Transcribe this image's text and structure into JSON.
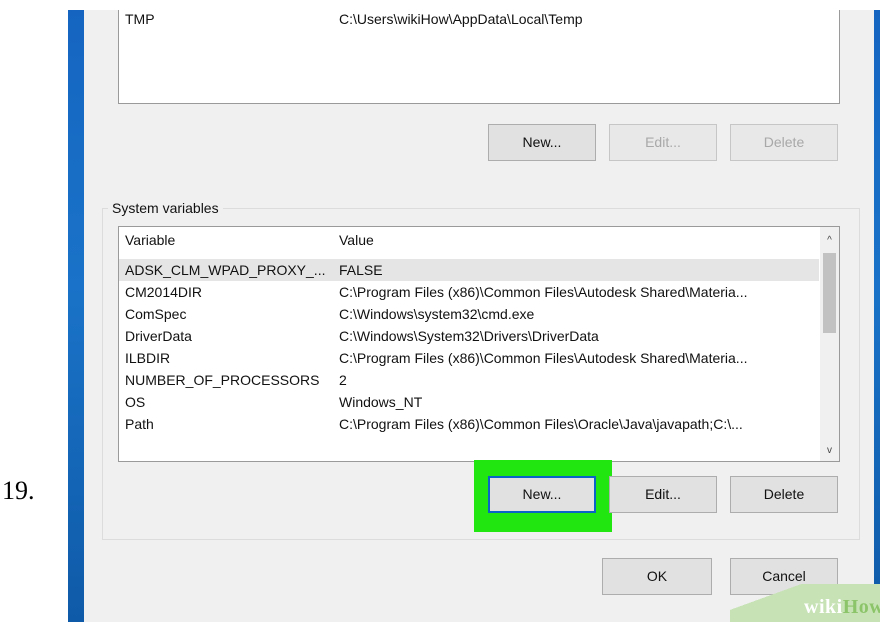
{
  "step": {
    "number": "19."
  },
  "user_variables": {
    "rows": [
      {
        "variable": "TMP",
        "value": "C:\\Users\\wikiHow\\AppData\\Local\\Temp"
      }
    ],
    "buttons": {
      "new": "New...",
      "edit": "Edit...",
      "delete": "Delete"
    }
  },
  "system_variables": {
    "group_label": "System variables",
    "columns": {
      "variable": "Variable",
      "value": "Value"
    },
    "rows": [
      {
        "variable": "ADSK_CLM_WPAD_PROXY_...",
        "value": "FALSE",
        "selected": true
      },
      {
        "variable": "CM2014DIR",
        "value": "C:\\Program Files (x86)\\Common Files\\Autodesk Shared\\Materia..."
      },
      {
        "variable": "ComSpec",
        "value": "C:\\Windows\\system32\\cmd.exe"
      },
      {
        "variable": "DriverData",
        "value": "C:\\Windows\\System32\\Drivers\\DriverData"
      },
      {
        "variable": "ILBDIR",
        "value": "C:\\Program Files (x86)\\Common Files\\Autodesk Shared\\Materia..."
      },
      {
        "variable": "NUMBER_OF_PROCESSORS",
        "value": "2"
      },
      {
        "variable": "OS",
        "value": "Windows_NT"
      },
      {
        "variable": "Path",
        "value": "C:\\Program Files (x86)\\Common Files\\Oracle\\Java\\javapath;C:\\..."
      }
    ],
    "scrollbar": {
      "up_icon": "chevron-up-icon",
      "down_icon": "chevron-down-icon",
      "up_glyph": "^",
      "down_glyph": "v"
    },
    "buttons": {
      "new": "New...",
      "edit": "Edit...",
      "delete": "Delete"
    }
  },
  "dialog_buttons": {
    "ok": "OK",
    "cancel": "Cancel"
  },
  "watermark": {
    "wiki": "wiki",
    "how": "How"
  },
  "colors": {
    "highlight": "#22e610",
    "desktop": "#1565c0",
    "dialog": "#f0f0f0"
  }
}
